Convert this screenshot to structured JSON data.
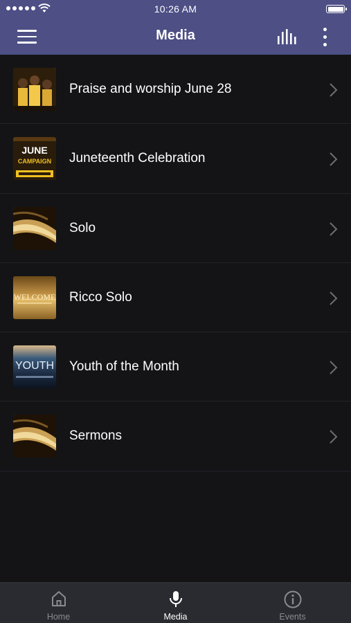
{
  "status_bar": {
    "time": "10:26 AM"
  },
  "nav": {
    "title": "Media"
  },
  "list": {
    "items": [
      {
        "label": "Praise and worship June 28",
        "thumb": "choir-photo"
      },
      {
        "label": "Juneteenth Celebration",
        "thumb": "june-campaign-poster",
        "thumb_text_1": "JUNE",
        "thumb_text_2": "CAMPAIGN"
      },
      {
        "label": "Solo",
        "thumb": "open-bible"
      },
      {
        "label": "Ricco Solo",
        "thumb": "welcome-banner",
        "thumb_text": "WELCOME"
      },
      {
        "label": "Youth of the Month",
        "thumb": "youth-banner",
        "thumb_text": "YOUTH"
      },
      {
        "label": "Sermons",
        "thumb": "open-bible"
      }
    ]
  },
  "tabs": [
    {
      "label": "Home",
      "icon": "home-icon",
      "active": false
    },
    {
      "label": "Media",
      "icon": "microphone-icon",
      "active": true
    },
    {
      "label": "Events",
      "icon": "info-icon",
      "active": false
    }
  ],
  "colors": {
    "header": "#4d4f85",
    "background": "#141416",
    "tab_bar": "#2a2b30",
    "tab_inactive": "#8a8b92",
    "tab_active": "#ffffff"
  }
}
